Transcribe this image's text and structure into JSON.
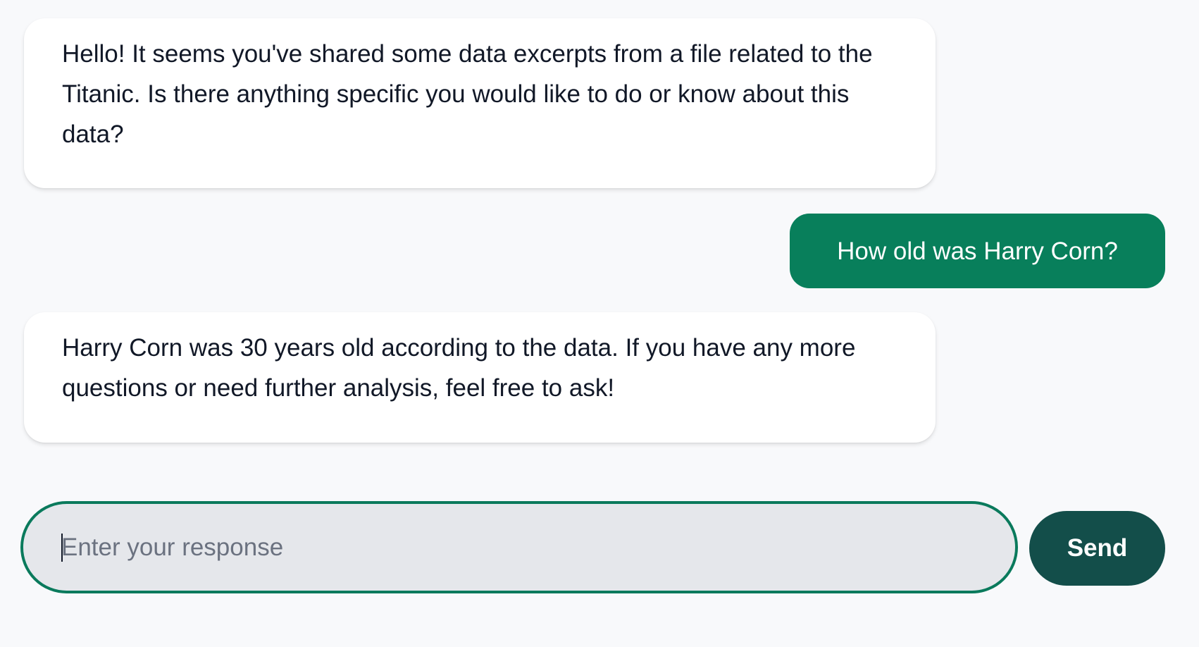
{
  "conversation": {
    "messages": [
      {
        "role": "assistant",
        "text": "Hello! It seems you've shared some data excerpts from a file related to the Titanic. Is there anything specific you would like to do or know about this data?"
      },
      {
        "role": "user",
        "text": "How old was Harry Corn?"
      },
      {
        "role": "assistant",
        "text": "Harry Corn was 30 years old according to the data. If you have any more questions or need further analysis, feel free to ask!"
      }
    ]
  },
  "composer": {
    "value": "",
    "placeholder": "Enter your response",
    "send_label": "Send"
  },
  "colors": {
    "background": "#f8f9fb",
    "user_bubble": "#087f5b",
    "input_border": "#0a7a5c",
    "input_fill": "#e5e7eb",
    "send_button": "#134e4a"
  }
}
